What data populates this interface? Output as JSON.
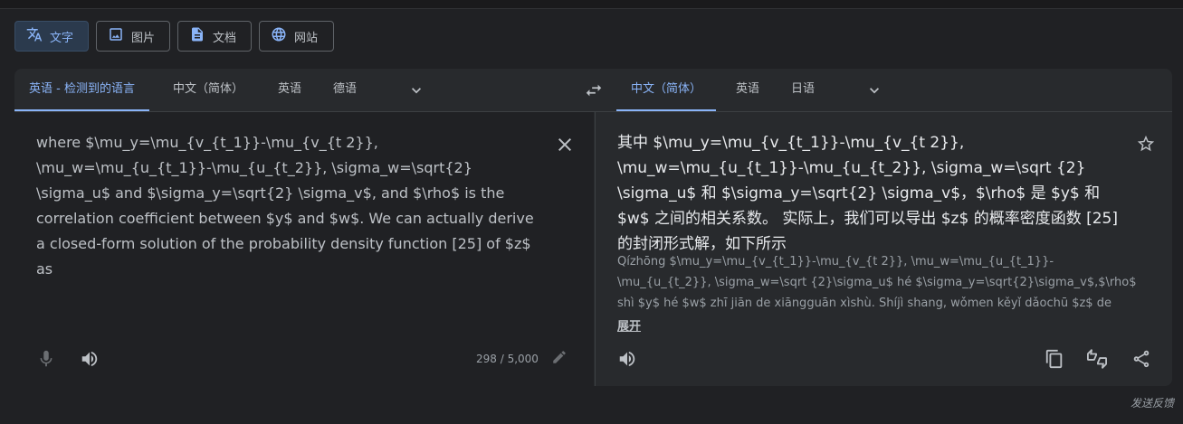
{
  "modes": [
    {
      "label": "文字",
      "icon": "translate-icon",
      "active": true
    },
    {
      "label": "图片",
      "icon": "image-icon",
      "active": false
    },
    {
      "label": "文档",
      "icon": "document-icon",
      "active": false
    },
    {
      "label": "网站",
      "icon": "globe-icon",
      "active": false
    }
  ],
  "source": {
    "tabs": [
      "英语 - 检测到的语言",
      "中文（简体）",
      "英语",
      "德语"
    ],
    "text": "where $\\mu_y=\\mu_{v_{t_1}}-\\mu_{v_{t 2}}, \\mu_w=\\mu_{u_{t_1}}-\\mu_{u_{t_2}}, \\sigma_w=\\sqrt{2} \\sigma_u$ and $\\sigma_y=\\sqrt{2} \\sigma_v$, and $\\rho$ is the correlation coefficient between $y$ and $w$. We can actually derive a closed-form solution of the probability density function [25] of $z$ as",
    "char_count": "298 / 5,000"
  },
  "target": {
    "tabs": [
      "中文（简体）",
      "英语",
      "日语"
    ],
    "text": "其中 $\\mu_y=\\mu_{v_{t_1}}-\\mu_{v_{t 2}}, \\mu_w=\\mu_{u_{t_1}}-\\mu_{u_{t_2}}, \\sigma_w=\\sqrt {2} \\sigma_u$ 和 $\\sigma_y=\\sqrt{2} \\sigma_v$，$\\rho$ 是 $y$ 和 $w$ 之间的相关系数。 实际上，我们可以导出 $z$ 的概率密度函数 [25] 的封闭形式解，如下所示",
    "transliteration": "Qízhōng $\\mu_y=\\mu_{v_{t_1}}-\\mu_{v_{t 2}}, \\mu_w=\\mu_{u_{t_1}}-\\mu_{u_{t_2}}, \\sigma_w=\\sqrt {2}\\sigma_u$ hé $\\sigma_y=\\sqrt{2}\\sigma_v$,$\\rho$ shì $y$ hé $w$ zhī jiān de xiāngguān xìshù. Shíjì shang, wǒmen kěyǐ dǎochū $z$ de gàilǜ mìdù hánshù",
    "expand_label": "展开"
  },
  "feedback_label": "发送反馈"
}
